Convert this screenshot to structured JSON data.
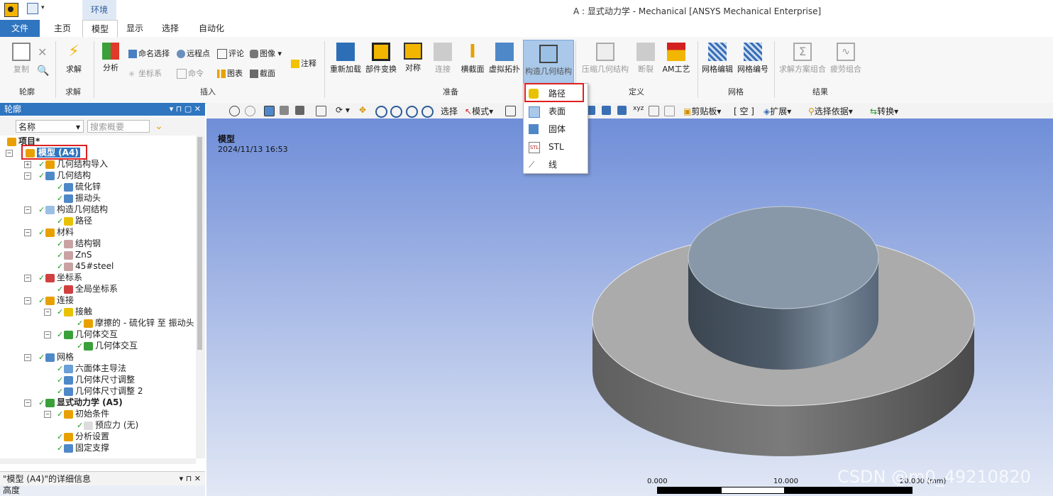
{
  "window": {
    "title": "A : 显式动力学 - Mechanical [ANSYS Mechanical Enterprise]",
    "context_tab": "环境"
  },
  "tabs": [
    "文件",
    "主页",
    "模型",
    "显示",
    "选择",
    "自动化"
  ],
  "ribbon": {
    "outline_group": {
      "copy": "复制",
      "label": "轮廓"
    },
    "solve_group": {
      "solve": "求解",
      "label": "求解"
    },
    "insert_group": {
      "analysis": "分析",
      "named_selection": "命名选择",
      "remote_point": "远程点",
      "comment": "评论",
      "image": "图像",
      "annotation": "注释",
      "coordinate_system": "坐标系",
      "command": "命令",
      "chart": "图表",
      "section": "截面",
      "label": "插入"
    },
    "prepare_group": {
      "reload": "重新加载",
      "part_transform": "部件变换",
      "symmetry": "对称",
      "connect": "连接",
      "cross_section": "横截面",
      "virtual_topology": "虚拟拓扑",
      "build_geometry": "构造几何结构",
      "label": "准备"
    },
    "define_group": {
      "condensed_geometry": "压缩几何结构",
      "fracture": "断裂",
      "am_process": "AM工艺",
      "label": "定义"
    },
    "mesh_group": {
      "mesh_edit": "网格编辑",
      "mesh_numbering": "网格编号",
      "label": "网格"
    },
    "results_group": {
      "solution_combination": "求解方案组合",
      "fatigue_combination": "疲劳组合",
      "label": "结果"
    }
  },
  "geometry_menu": {
    "items": [
      "路径",
      "表面",
      "固体",
      "STL",
      "线"
    ]
  },
  "outline": {
    "title": "轮廓",
    "filter_name": "名称",
    "search_placeholder": "搜索概要",
    "tree": [
      "项目*",
      "模型 (A4)",
      "几何结构导入",
      "几何结构",
      "硫化锌",
      "振动头",
      "构造几何结构",
      "路径",
      "材料",
      "结构钢",
      "ZnS",
      "45#steel",
      "坐标系",
      "全局坐标系",
      "连接",
      "接触",
      "摩擦的 - 硫化锌 至 振动头",
      "几何体交互",
      "几何体交互",
      "网格",
      "六面体主导法",
      "几何体尺寸调整",
      "几何体尺寸调整 2",
      "显式动力学 (A5)",
      "初始条件",
      "预应力 (无)",
      "分析设置",
      "固定支撑"
    ]
  },
  "details": {
    "title": "\"模型 (A4)\"的详细信息",
    "first_row": "高度"
  },
  "graphics_toolbar": {
    "select": "选择",
    "mode": "模式",
    "clipboard": "剪贴板",
    "empty": "[ 空 ]",
    "extend": "扩展",
    "select_by": "选择依据",
    "convert": "转换"
  },
  "viewport": {
    "title": "模型",
    "date": "2024/11/13 16:53",
    "scale_labels": [
      "0.000",
      "10.000",
      "20.000 (mm)"
    ]
  },
  "watermark": "CSDN @m0_49210820",
  "colors": {
    "accent": "#2f75c0",
    "highlight": "#e02020",
    "selected_button": "#a9c8ea"
  }
}
